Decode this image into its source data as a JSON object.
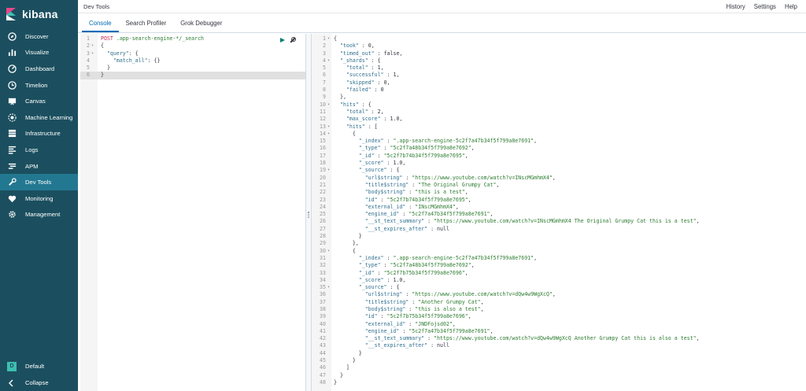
{
  "app": {
    "brand": "kibana",
    "title": "Dev Tools"
  },
  "header": {
    "links": [
      "History",
      "Settings",
      "Help"
    ]
  },
  "tabs": [
    {
      "label": "Console",
      "active": true
    },
    {
      "label": "Search Profiler",
      "active": false
    },
    {
      "label": "Grok Debugger",
      "active": false
    }
  ],
  "sidebar": {
    "items": [
      {
        "label": "Discover",
        "icon": "compass-icon"
      },
      {
        "label": "Visualize",
        "icon": "bar-chart-icon"
      },
      {
        "label": "Dashboard",
        "icon": "dashboard-icon"
      },
      {
        "label": "Timelion",
        "icon": "timelion-icon"
      },
      {
        "label": "Canvas",
        "icon": "canvas-icon"
      },
      {
        "label": "Machine Learning",
        "icon": "ml-icon"
      },
      {
        "label": "Infrastructure",
        "icon": "infrastructure-icon"
      },
      {
        "label": "Logs",
        "icon": "logs-icon"
      },
      {
        "label": "APM",
        "icon": "apm-icon"
      },
      {
        "label": "Dev Tools",
        "icon": "wrench-icon",
        "active": true
      },
      {
        "label": "Monitoring",
        "icon": "heartbeat-icon"
      },
      {
        "label": "Management",
        "icon": "gear-icon"
      }
    ],
    "bottom": [
      {
        "label": "Default",
        "avatar": "D"
      },
      {
        "label": "Collapse",
        "icon": "collapse-icon"
      }
    ]
  },
  "colors": {
    "sidebar": "#1b4f5f",
    "active": "#237891",
    "accent": "#006bb4"
  },
  "request_lines": [
    "POST .app-search-engine-*/_search",
    "{",
    "  \"query\": {",
    "    \"match_all\": {}",
    "  }",
    "}"
  ],
  "response_lines": [
    "{",
    "  \"took\" : 0,",
    "  \"timed_out\" : false,",
    "  \"_shards\" : {",
    "    \"total\" : 1,",
    "    \"successful\" : 1,",
    "    \"skipped\" : 0,",
    "    \"failed\" : 0",
    "  },",
    "  \"hits\" : {",
    "    \"total\" : 2,",
    "    \"max_score\" : 1.0,",
    "    \"hits\" : [",
    "      {",
    "        \"_index\" : \".app-search-engine-5c2f7a47b34f5f799a8e7691\",",
    "        \"_type\" : \"5c2f7a48b34f5f799a8e7692\",",
    "        \"_id\" : \"5c2f7b74b34f5f799a8e7695\",",
    "        \"_score\" : 1.0,",
    "        \"_source\" : {",
    "          \"url$string\" : \"https://www.youtube.com/watch?v=INscMGmhmX4\",",
    "          \"title$string\" : \"The Original Grumpy Cat\",",
    "          \"body$string\" : \"this is a test\",",
    "          \"id\" : \"5c2f7b74b34f5f799a8e7695\",",
    "          \"external_id\" : \"INscMGmhmX4\",",
    "          \"engine_id\" : \"5c2f7a47b34f5f799a8e7691\",",
    "          \"__st_text_summary\" : \"https://www.youtube.com/watch?v=INscMGmhmX4 The Original Grumpy Cat this is a test\",",
    "          \"__st_expires_after\" : null",
    "        }",
    "      },",
    "      {",
    "        \"_index\" : \".app-search-engine-5c2f7a47b34f5f799a8e7691\",",
    "        \"_type\" : \"5c2f7a48b34f5f799a8e7692\",",
    "        \"_id\" : \"5c2f7b75b34f5f799a8e7696\",",
    "        \"_score\" : 1.0,",
    "        \"_source\" : {",
    "          \"url$string\" : \"https://www.youtube.com/watch?v=dQw4w9WgXcQ\",",
    "          \"title$string\" : \"Another Grumpy Cat\",",
    "          \"body$string\" : \"this is also a test\",",
    "          \"id\" : \"5c2f7b75b34f5f799a8e7696\",",
    "          \"external_id\" : \"JNDFojsd02\",",
    "          \"engine_id\" : \"5c2f7a47b34f5f799a8e7691\",",
    "          \"__st_text_summary\" : \"https://www.youtube.com/watch?v=dQw4w9WgXcQ Another Grumpy Cat this is also a test\",",
    "          \"__st_expires_after\" : null",
    "        }",
    "      }",
    "    ]",
    "  }",
    "}"
  ]
}
